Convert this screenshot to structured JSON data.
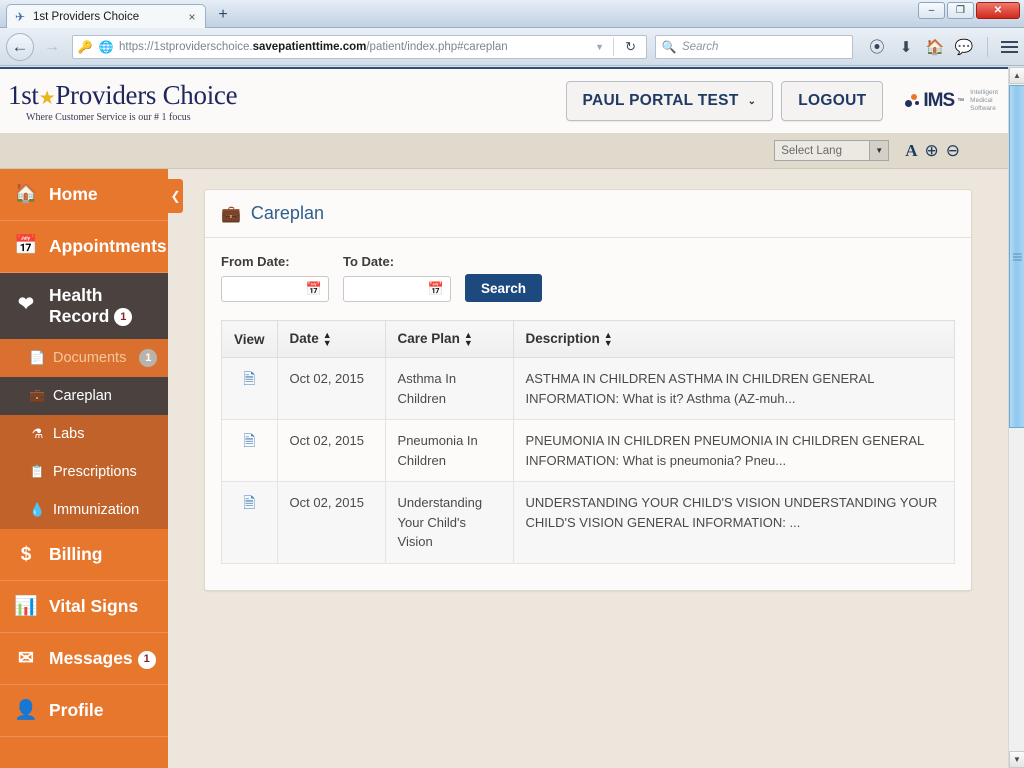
{
  "browser": {
    "tab_title": "1st Providers Choice",
    "tab_favicon": "site-favicon",
    "tab_close": "×",
    "new_tab": "+",
    "minimize": "–",
    "maximize": "❐",
    "close": "✕",
    "back": "←",
    "forward": "→",
    "url_prefix": "https://1stproviderschoice.",
    "url_domain": "savepatienttime.com",
    "url_suffix": "/patient/index.php#careplan",
    "reload": "↻",
    "search_placeholder": "Search",
    "toolbar_icons": [
      "pocket-icon",
      "downloads-icon",
      "home-icon",
      "chat-icon",
      "menu-icon"
    ]
  },
  "header": {
    "logo_pre": "1st",
    "logo_star": "★",
    "logo_post": "Providers Choice",
    "logo_tagline": "Where Customer Service is our # 1 focus",
    "user_button": "PAUL PORTAL TEST",
    "user_caret": "⌄",
    "logout_button": "LOGOUT",
    "ims_name": "IMS",
    "ims_tm": "™",
    "ims_tagline": "Intelligent\nMedical\nSoftware"
  },
  "langbar": {
    "select_value": "Select Lang",
    "select_arrow": "▼",
    "font_icon": "A",
    "zoom_in_icon": "⊕",
    "zoom_out_icon": "⊖"
  },
  "sidebar": {
    "collapse_icon": "❮",
    "items": [
      {
        "label": "Home",
        "icon": "home-icon",
        "glyph": "⌂",
        "state": "normal"
      },
      {
        "label": "Appointments",
        "icon": "calendar-icon",
        "glyph": "▦",
        "state": "normal"
      },
      {
        "label": "Health Record",
        "icon": "heartbeat-icon",
        "glyph": "♥",
        "state": "active",
        "badge": "1"
      },
      {
        "label": "Billing",
        "icon": "dollar-icon",
        "glyph": "$",
        "state": "normal"
      },
      {
        "label": "Vital Signs",
        "icon": "bar-chart-icon",
        "glyph": "█",
        "state": "normal"
      },
      {
        "label": "Messages",
        "icon": "envelope-icon",
        "glyph": "✉",
        "state": "normal",
        "badge": "1"
      },
      {
        "label": "Profile",
        "icon": "user-icon",
        "glyph": "●",
        "state": "normal"
      }
    ],
    "submenu": [
      {
        "label": "Documents",
        "icon": "file-icon",
        "glyph": "🗎",
        "state": "hovered",
        "badge": "1"
      },
      {
        "label": "Careplan",
        "icon": "briefcase-medical-icon",
        "glyph": "⊕",
        "state": "selected"
      },
      {
        "label": "Labs",
        "icon": "flask-icon",
        "glyph": "⚗",
        "state": "normal"
      },
      {
        "label": "Prescriptions",
        "icon": "prescription-icon",
        "glyph": "☷",
        "state": "normal"
      },
      {
        "label": "Immunization",
        "icon": "droplet-icon",
        "glyph": "●",
        "state": "normal"
      }
    ]
  },
  "careplan": {
    "panel_icon": "briefcase-medical-icon",
    "panel_title": "Careplan",
    "from_label": "From Date:",
    "from_value": "",
    "to_label": "To Date:",
    "to_value": "",
    "calendar_icon": "calendar-icon",
    "search_button": "Search",
    "columns": [
      "View",
      "Date",
      "Care Plan",
      "Description"
    ],
    "sortable": [
      false,
      true,
      true,
      true
    ],
    "rows": [
      {
        "view_icon": "document-icon",
        "date": "Oct 02, 2015",
        "care_plan": "Asthma In Children",
        "description": "ASTHMA IN CHILDREN ASTHMA IN CHILDREN GENERAL INFORMATION: What is it? Asthma (AZ-muh..."
      },
      {
        "view_icon": "document-icon",
        "date": "Oct 02, 2015",
        "care_plan": "Pneumonia In Children",
        "description": "PNEUMONIA IN CHILDREN PNEUMONIA IN CHILDREN GENERAL INFORMATION: What is pneumonia? Pneu..."
      },
      {
        "view_icon": "document-icon",
        "date": "Oct 02, 2015",
        "care_plan": "Understanding Your Child's Vision",
        "description": "UNDERSTANDING YOUR CHILD'S VISION UNDERSTANDING YOUR CHILD'S VISION GENERAL INFORMATION: ..."
      }
    ]
  },
  "colors": {
    "sidebar_orange": "#e8772e",
    "submenu_orange": "#c0622a",
    "active_dark": "#4b4240",
    "page_bg": "#ece6dc",
    "accent_blue": "#1c4a7e",
    "title_blue": "#2e5f8a",
    "logo_navy": "#20275e"
  }
}
